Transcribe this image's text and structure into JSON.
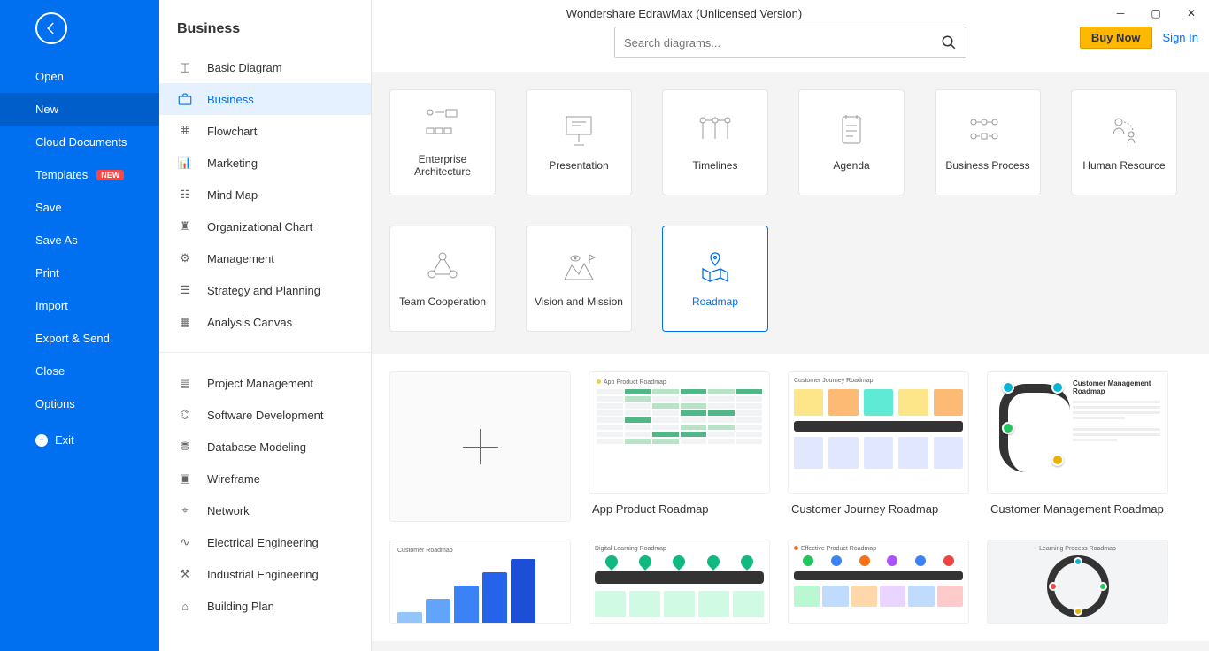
{
  "app_title": "Wondershare EdrawMax (Unlicensed Version)",
  "top_right": {
    "buy": "Buy Now",
    "signin": "Sign In"
  },
  "sidebar": {
    "items": [
      {
        "label": "Open"
      },
      {
        "label": "New"
      },
      {
        "label": "Cloud Documents"
      },
      {
        "label": "Templates",
        "badge": "NEW"
      },
      {
        "label": "Save"
      },
      {
        "label": "Save As"
      },
      {
        "label": "Print"
      },
      {
        "label": "Import"
      },
      {
        "label": "Export & Send"
      },
      {
        "label": "Close"
      },
      {
        "label": "Options"
      }
    ],
    "exit": "Exit"
  },
  "category_panel": {
    "title": "Business",
    "group1": [
      "Basic Diagram",
      "Business",
      "Flowchart",
      "Marketing",
      "Mind Map",
      "Organizational Chart",
      "Management",
      "Strategy and Planning",
      "Analysis Canvas"
    ],
    "group2": [
      "Project Management",
      "Software Development",
      "Database Modeling",
      "Wireframe",
      "Network",
      "Electrical Engineering",
      "Industrial Engineering",
      "Building Plan"
    ]
  },
  "search": {
    "placeholder": "Search diagrams..."
  },
  "tiles": [
    "Enterprise Architecture",
    "Presentation",
    "Timelines",
    "Agenda",
    "Business Process",
    "Human Resource",
    "Team Cooperation",
    "Vision and Mission",
    "Roadmap"
  ],
  "templates": [
    "",
    "App Product Roadmap",
    "Customer Journey Roadmap",
    "Customer Management Roadmap",
    "Customer Roadmap",
    "Digital Learning Roadmap",
    "Effective Product Roadmap",
    "Learning Process Roadmap"
  ]
}
